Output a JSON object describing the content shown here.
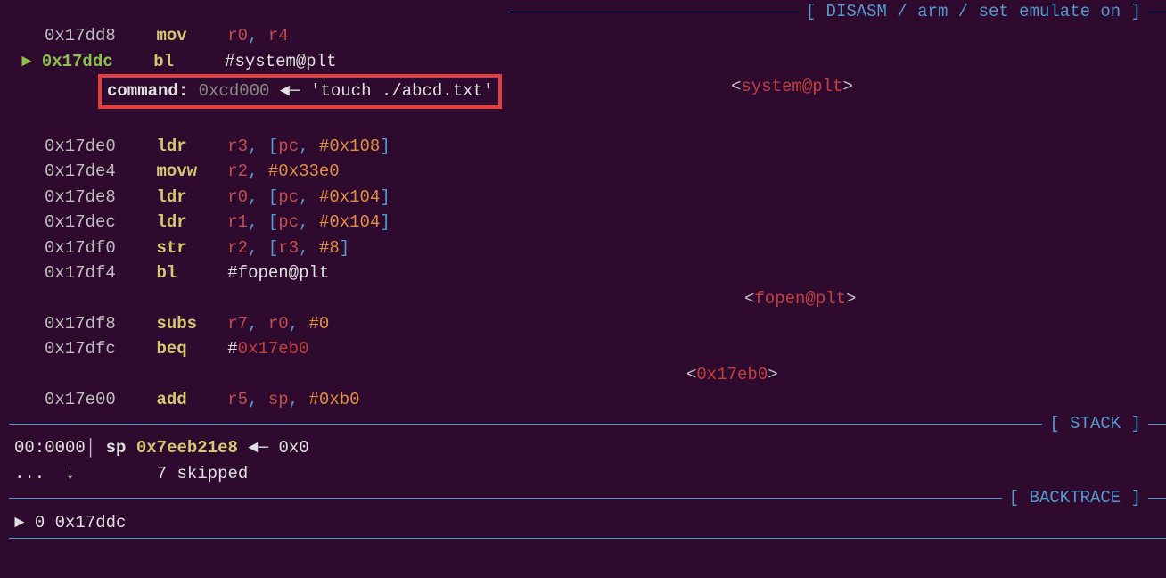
{
  "sections": {
    "disasm_label": "[ DISASM / arm / set emulate on ]",
    "stack_label": "[ STACK ]",
    "backtrace_label": "[ BACKTRACE ]"
  },
  "disasm": {
    "l1": {
      "addr": "0x17dd8",
      "mnem": "mov",
      "op1": "r0",
      "op2": "r4"
    },
    "l2": {
      "marker": "►",
      "addr": "0x17ddc",
      "mnem": "bl",
      "target": "#system@plt",
      "annot_open": "<",
      "annot_func": "system@plt",
      "annot_close": ">"
    },
    "cmd": {
      "label": "command:",
      "addr": "0xcd000",
      "arrow": "◄─",
      "value": "'touch ./abcd.txt'"
    },
    "l3": {
      "addr": "0x17de0",
      "mnem": "ldr",
      "reg": "r3",
      "pc": "pc",
      "off": "#0x108"
    },
    "l4": {
      "addr": "0x17de4",
      "mnem": "movw",
      "reg": "r2",
      "imm": "#0x33e0"
    },
    "l5": {
      "addr": "0x17de8",
      "mnem": "ldr",
      "reg": "r0",
      "pc": "pc",
      "off": "#0x104"
    },
    "l6": {
      "addr": "0x17dec",
      "mnem": "ldr",
      "reg": "r1",
      "pc": "pc",
      "off": "#0x104"
    },
    "l7": {
      "addr": "0x17df0",
      "mnem": "str",
      "reg": "r2",
      "base": "r3",
      "off": "#8"
    },
    "l8": {
      "addr": "0x17df4",
      "mnem": "bl",
      "target": "#fopen@plt",
      "annot_open": "<",
      "annot_func": "fopen@plt",
      "annot_close": ">"
    },
    "l9": {
      "addr": "0x17df8",
      "mnem": "subs",
      "r1": "r7",
      "r2": "r0",
      "imm": "#0"
    },
    "l10": {
      "addr": "0x17dfc",
      "mnem": "beq",
      "hash": "#",
      "target": "0x17eb0",
      "annot_open": "<",
      "annot_addr": "0x17eb0",
      "annot_close": ">"
    },
    "l11": {
      "addr": "0x17e00",
      "mnem": "add",
      "r1": "r5",
      "r2": "sp",
      "imm": "#0xb0"
    }
  },
  "stack": {
    "idx": "00:",
    "off": "0000",
    "pipe": "│",
    "reg": "sp",
    "addr": "0x7eeb21e8",
    "arrow": "◄─",
    "val": "0x0",
    "skip_dots": "...",
    "skip_arrow": "↓",
    "skip_count": "7 skipped"
  },
  "backtrace": {
    "marker": "►",
    "idx": "0",
    "addr": "0x17ddc"
  }
}
